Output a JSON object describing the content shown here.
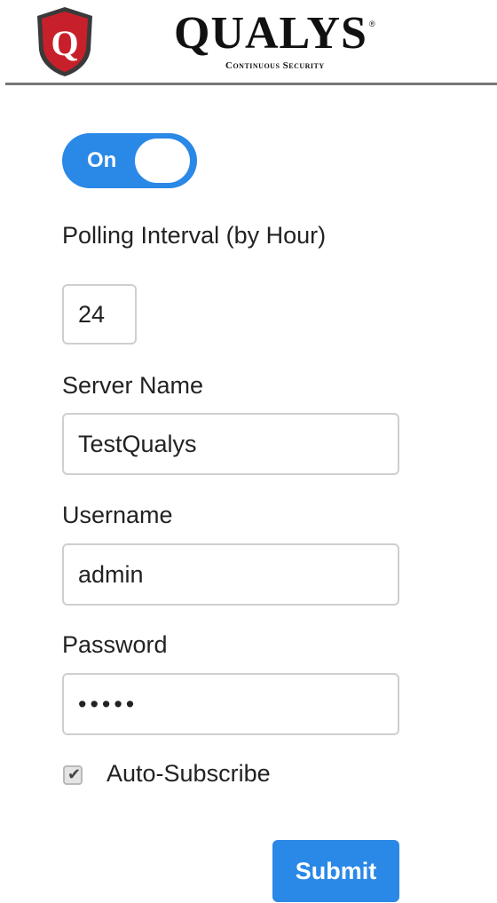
{
  "header": {
    "brand_name": "QUALYS",
    "brand_registered": "®",
    "brand_tagline": "Continuous Security",
    "logo_letter": "Q",
    "logo_icon": "qualys-shield-icon"
  },
  "polling": {
    "toggle_label": "On",
    "toggle_state": "on",
    "interval_label": "Polling Interval (by Hour)",
    "interval_value": "24"
  },
  "server": {
    "label": "Server Name",
    "value": "TestQualys"
  },
  "username": {
    "label": "Username",
    "value": "admin"
  },
  "password": {
    "label": "Password",
    "value": "•••••"
  },
  "auto_subscribe": {
    "label": "Auto-Subscribe",
    "checked": true,
    "check_glyph": "✔"
  },
  "actions": {
    "submit_label": "Submit"
  },
  "colors": {
    "accent": "#2a88e6",
    "shield_red": "#c8202b",
    "shield_dark": "#3a3a3a",
    "rule": "#777777"
  }
}
